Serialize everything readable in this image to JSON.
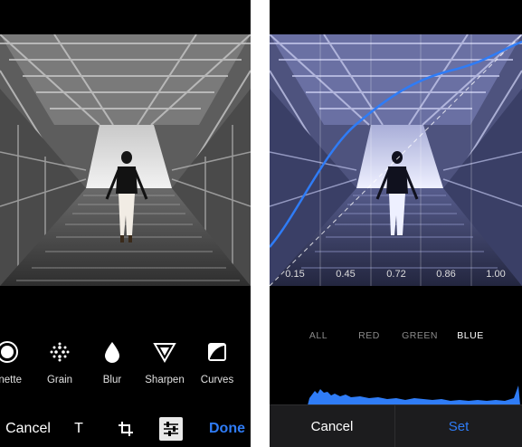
{
  "left_screen": {
    "tools": [
      {
        "label": "gnette",
        "icon": "vignette-icon"
      },
      {
        "label": "Grain",
        "icon": "grain-icon"
      },
      {
        "label": "Blur",
        "icon": "blur-drop-icon"
      },
      {
        "label": "Sharpen",
        "icon": "sharpen-triangle-icon"
      },
      {
        "label": "Curves",
        "icon": "curves-icon"
      }
    ],
    "bottom_bar": {
      "cancel": "Cancel",
      "text_tool": "T",
      "crop_icon": "crop-icon",
      "adjust_icon": "sliders-icon",
      "done": "Done"
    },
    "colors": {
      "accent": "#2f7cf6"
    }
  },
  "right_screen": {
    "curve_values": [
      "0.15",
      "0.45",
      "0.72",
      "0.86",
      "1.00"
    ],
    "channels": [
      "ALL",
      "RED",
      "GREEN",
      "BLUE"
    ],
    "active_channel": "BLUE",
    "cancel": "Cancel",
    "set": "Set",
    "colors": {
      "curve": "#2f7cf6",
      "histogram": "#2f7cf6",
      "set": "#2f7cf6"
    }
  }
}
